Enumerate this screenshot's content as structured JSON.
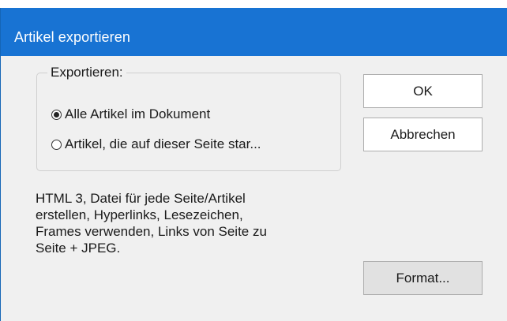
{
  "window": {
    "title": "Artikel exportieren"
  },
  "export_group": {
    "legend": "Exportieren:",
    "options": [
      {
        "label": "Alle Artikel im Dokument",
        "selected": true
      },
      {
        "label": "Artikel, die auf dieser Seite star...",
        "selected": false
      }
    ]
  },
  "buttons": {
    "ok_label": "OK",
    "cancel_label": "Abbrechen",
    "format_label": "Format..."
  },
  "description": {
    "lines": [
      "HTML 3, Datei für jede Seite/Artikel",
      "erstellen, Hyperlinks, Lesezeichen,",
      "Frames verwenden, Links von Seite zu",
      "Seite + JPEG."
    ]
  },
  "colors": {
    "titlebar": "#1873d3",
    "dialog_background": "#f0f0f0",
    "title_text": "#ffffff"
  }
}
